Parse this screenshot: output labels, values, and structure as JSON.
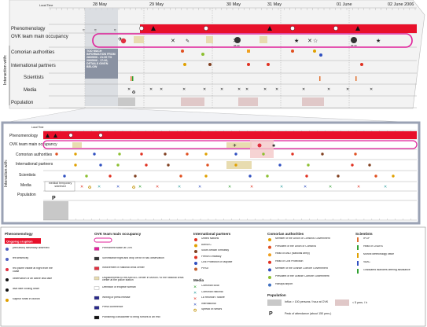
{
  "timeline": {
    "top_header_left": "Local Time",
    "top_dates": [
      "28 May",
      "29 May",
      "30 May",
      "31 May",
      "01 June",
      "02 June 2006"
    ],
    "zoom_header_left": "Local Time",
    "row_labels_top": [
      "Phenomenology",
      "OVK team main occupancy",
      "Comorian authorities",
      "International partners",
      "Scientists",
      "Media",
      "Population"
    ],
    "row_labels_zoom": [
      "Phenomenology",
      "OVK team main occupancy",
      "Comorian authorities",
      "International partners",
      "Scientists",
      "Media",
      "Population"
    ],
    "group_label": "Interaction with:",
    "callout": "TOO MUCH INFORMATION FROM 28/05/06 - 21:00 TO 29/05/06 - 17:00, DETAILS GIVEN BELOW",
    "zoom_note": "medical temporary sidelined",
    "zoom_p": "P",
    "clock_labels": [
      "06:00",
      "06:30",
      "18:10",
      "06:00"
    ]
  },
  "legend": {
    "phenomenology": {
      "title": "Phenomenology",
      "ongoing": "Ongoing eruption",
      "items": [
        "precursory seismicity observed",
        "felt seismicity",
        "red plume visible at night from the coast",
        "observation of an active lava lake",
        "lava lake cooling down",
        "sulphur smell in Moroni"
      ]
    },
    "ovk": {
      "title": "OVK team main occupancy",
      "items": [
        "Permanent watch at OVK",
        "Surveillance flight and drop off for in situ observation",
        "Involvement in national crisis center",
        "Displacements to the AMISEC center in Moroni / to the national crisis center at the police station",
        "Definition of eruptive scenari",
        "Writing of press release",
        "Press conference",
        "Publishing a disclaimer to bring rumors to an end"
      ]
    },
    "international": {
      "title": "International partners",
      "items": [
        "United Nations",
        "AMISEC",
        "South African Embassy",
        "French Embassy",
        "Civil Protection of Mayotte",
        "PIROI"
      ]
    },
    "media": {
      "title": "Media",
      "items": [
        "Comorian local",
        "Comorian national",
        "La Reunion / Maore",
        "International",
        "Spread of rumors"
      ]
    },
    "comorian": {
      "title": "Comorian authorities",
      "items": [
        "Member of the Union of Comoros Government",
        "President of the Union of Comoros",
        "Head of AND (National army)",
        "Head of Civil Protection",
        "Member of the Grande Comore Government",
        "President of the Grande Comore Government",
        "Hahaya airport"
      ]
    },
    "scientists": {
      "title": "Scientists",
      "items": [
        "IPGP",
        "Head of CNDRS",
        "Moroni Meteorology office",
        "VAAC",
        "Graduated islanders offering assistance"
      ]
    },
    "population": {
      "title": "Population",
      "items": [
        "Influx > 100 persons / hour at OVK",
        "< 5 pers. / h",
        "Peak of attendance (about 150 pers.)"
      ],
      "p_symbol": "P"
    }
  }
}
